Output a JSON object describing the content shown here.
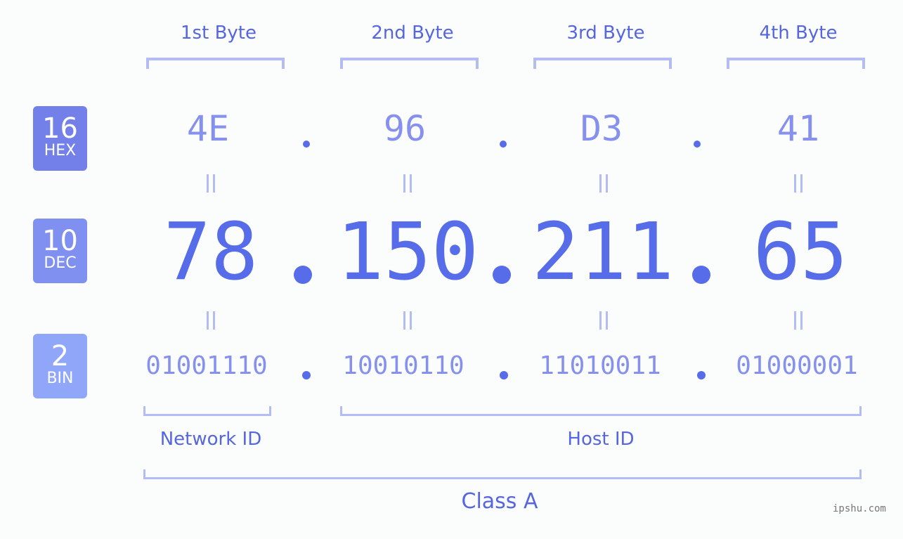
{
  "bytes": {
    "labels": [
      "1st Byte",
      "2nd Byte",
      "3rd Byte",
      "4th Byte"
    ]
  },
  "badges": {
    "hex": {
      "num": "16",
      "label": "HEX",
      "color": "#7480ea"
    },
    "dec": {
      "num": "10",
      "label": "DEC",
      "color": "#8090f0"
    },
    "bin": {
      "num": "2",
      "label": "BIN",
      "color": "#90a6f8"
    }
  },
  "ip": {
    "hex": [
      "4E",
      "96",
      "D3",
      "41"
    ],
    "dec": [
      "78",
      "150",
      "211",
      "65"
    ],
    "bin": [
      "01001110",
      "10010110",
      "11010011",
      "01000001"
    ]
  },
  "sections": {
    "network_id": "Network ID",
    "host_id": "Host ID",
    "class": "Class A"
  },
  "watermark": "ipshu.com",
  "colors": {
    "accent": "#566ce9",
    "light_accent": "#8590ef",
    "bracket": "#b4bcf6"
  }
}
